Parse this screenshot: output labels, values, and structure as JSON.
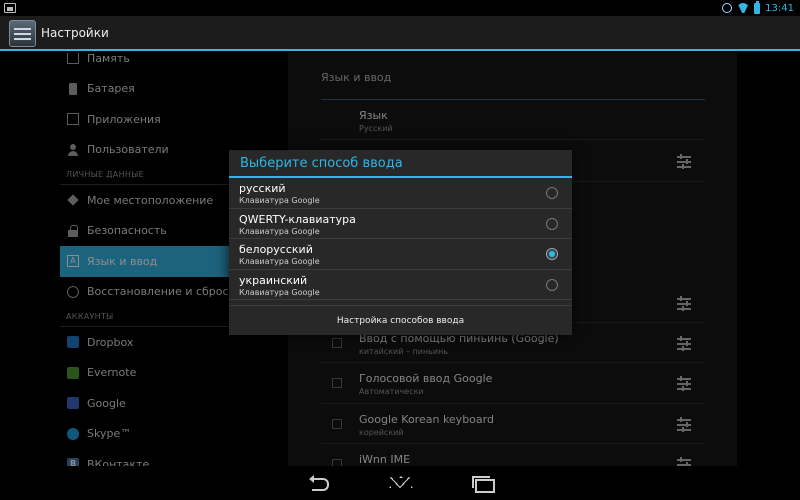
{
  "status_bar": {
    "time": "13:41"
  },
  "action_bar": {
    "title": "Настройки"
  },
  "left_menu": {
    "items_top": [
      {
        "label": "Память",
        "icon": "memory-icon"
      },
      {
        "label": "Батарея",
        "icon": "battery-icon"
      },
      {
        "label": "Приложения",
        "icon": "apps-icon"
      },
      {
        "label": "Пользователи",
        "icon": "users-icon"
      }
    ],
    "section_personal": "ЛИЧНЫЕ ДАННЫЕ",
    "items_personal": [
      {
        "label": "Мое местоположение",
        "icon": "location-icon"
      },
      {
        "label": "Безопасность",
        "icon": "lock-icon"
      },
      {
        "label": "Язык и ввод",
        "icon": "language-icon",
        "selected": true,
        "icon_glyph": "A"
      },
      {
        "label": "Восстановление и сброс",
        "icon": "reset-icon"
      }
    ],
    "section_accounts": "АККАУНТЫ",
    "items_accounts": [
      {
        "label": "Dropbox",
        "icon": "dropbox-icon"
      },
      {
        "label": "Evernote",
        "icon": "evernote-icon"
      },
      {
        "label": "Google",
        "icon": "google-icon"
      },
      {
        "label": "Skype™",
        "icon": "skype-icon"
      },
      {
        "label": "ВКонтакте",
        "icon": "vk-icon",
        "icon_glyph": "B"
      }
    ]
  },
  "right_pane": {
    "header": "Язык и ввод",
    "language": {
      "title": "Язык",
      "value": "Русский"
    },
    "ime_rows": [
      {
        "title": "Ввод с помощью пиньинь (Google)",
        "sub": "китайский – пиньинь"
      },
      {
        "title": "Голосовой ввод Google",
        "sub": "Автоматически"
      },
      {
        "title": "Google Korean keyboard",
        "sub": "корейский"
      },
      {
        "title": "iWnn IME",
        "sub": ""
      }
    ]
  },
  "dialog": {
    "title": "Выберите способ ввода",
    "options": [
      {
        "name": "русский",
        "sub": "Клавиатура Google",
        "selected": false
      },
      {
        "name": "QWERTY-клавиатура",
        "sub": "Клавиатура Google",
        "selected": false
      },
      {
        "name": "белорусский",
        "sub": "Клавиатура Google",
        "selected": true
      },
      {
        "name": "украинский",
        "sub": "Клавиатура Google",
        "selected": false
      }
    ],
    "footer": "Настройка способов ввода"
  },
  "colors": {
    "accent": "#33b5e5",
    "background": "#000000",
    "dialog": "#282828"
  }
}
